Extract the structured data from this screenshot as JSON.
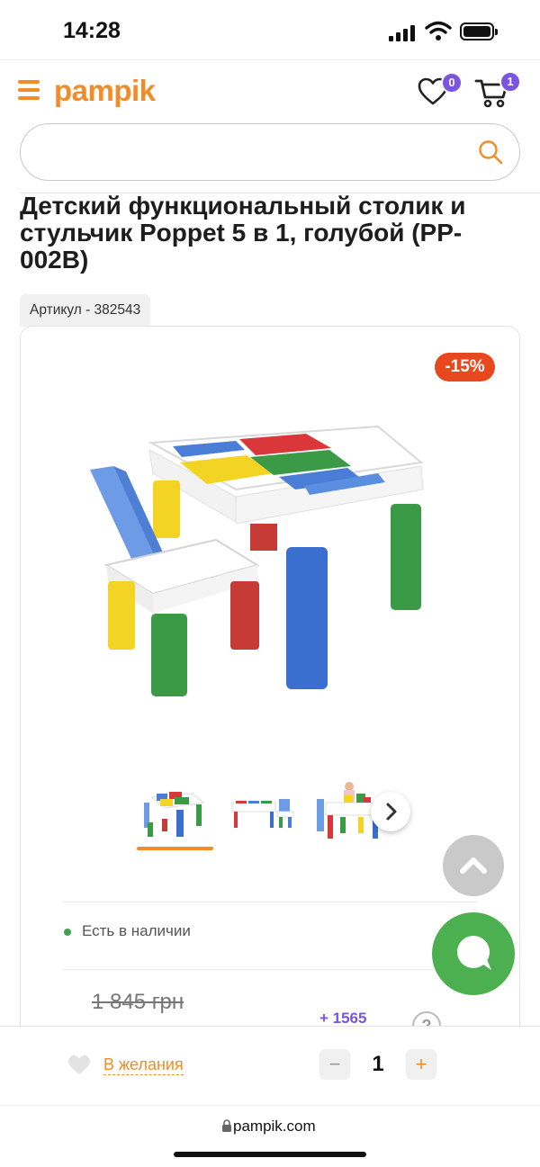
{
  "status_bar": {
    "time": "14:28"
  },
  "header": {
    "logo": "pampik",
    "wishlist_count": "0",
    "cart_count": "1",
    "accent_color": "#f28c28",
    "badge_color": "#7b55e0"
  },
  "search": {
    "value": "",
    "placeholder": ""
  },
  "product": {
    "title": "Детский функциональный столик и стульчик Poppet 5 в 1, голубой (PP-002B)",
    "sku": "Артикул - 382543",
    "discount": "-15%",
    "availability": "Есть в наличии",
    "old_price": "1 845 грн",
    "bonus": "+ 1565",
    "help": "?"
  },
  "gallery": {
    "thumbnails": [
      "table-and-chair",
      "table-side-view",
      "child-playing"
    ],
    "active_index": 0
  },
  "bottom_bar": {
    "wishlist_label": "В желания",
    "quantity": "1",
    "minus": "−",
    "plus": "+"
  },
  "browser": {
    "url": "pampik.com"
  }
}
